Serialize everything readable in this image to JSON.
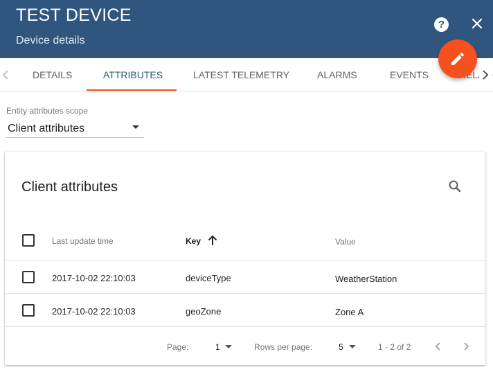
{
  "header": {
    "title": "TEST DEVICE",
    "subtitle": "Device details",
    "help_icon_glyph": "?",
    "background_color": "#305680",
    "accent_color": "#f4511e"
  },
  "tabs": [
    {
      "label": "DETAILS",
      "active": false
    },
    {
      "label": "ATTRIBUTES",
      "active": true
    },
    {
      "label": "LATEST TELEMETRY",
      "active": false
    },
    {
      "label": "ALARMS",
      "active": false
    },
    {
      "label": "EVENTS",
      "active": false
    },
    {
      "label": "RELATIONS",
      "active": false
    }
  ],
  "scope": {
    "label": "Entity attributes scope",
    "value": "Client attributes"
  },
  "table": {
    "title": "Client attributes",
    "columns": [
      "Last update time",
      "Key",
      "Value"
    ],
    "sorted_column": "Key",
    "sort_direction": "ascending",
    "rows": [
      {
        "time": "2017-10-02 22:10:03",
        "key": "deviceType",
        "value": "WeatherStation"
      },
      {
        "time": "2017-10-02 22:10:03",
        "key": "geoZone",
        "value": "Zone A"
      }
    ]
  },
  "pagination": {
    "page_label": "Page:",
    "page_value": "1",
    "rows_label": "Rows per page:",
    "rows_value": "5",
    "range": "1 - 2 of 2"
  }
}
